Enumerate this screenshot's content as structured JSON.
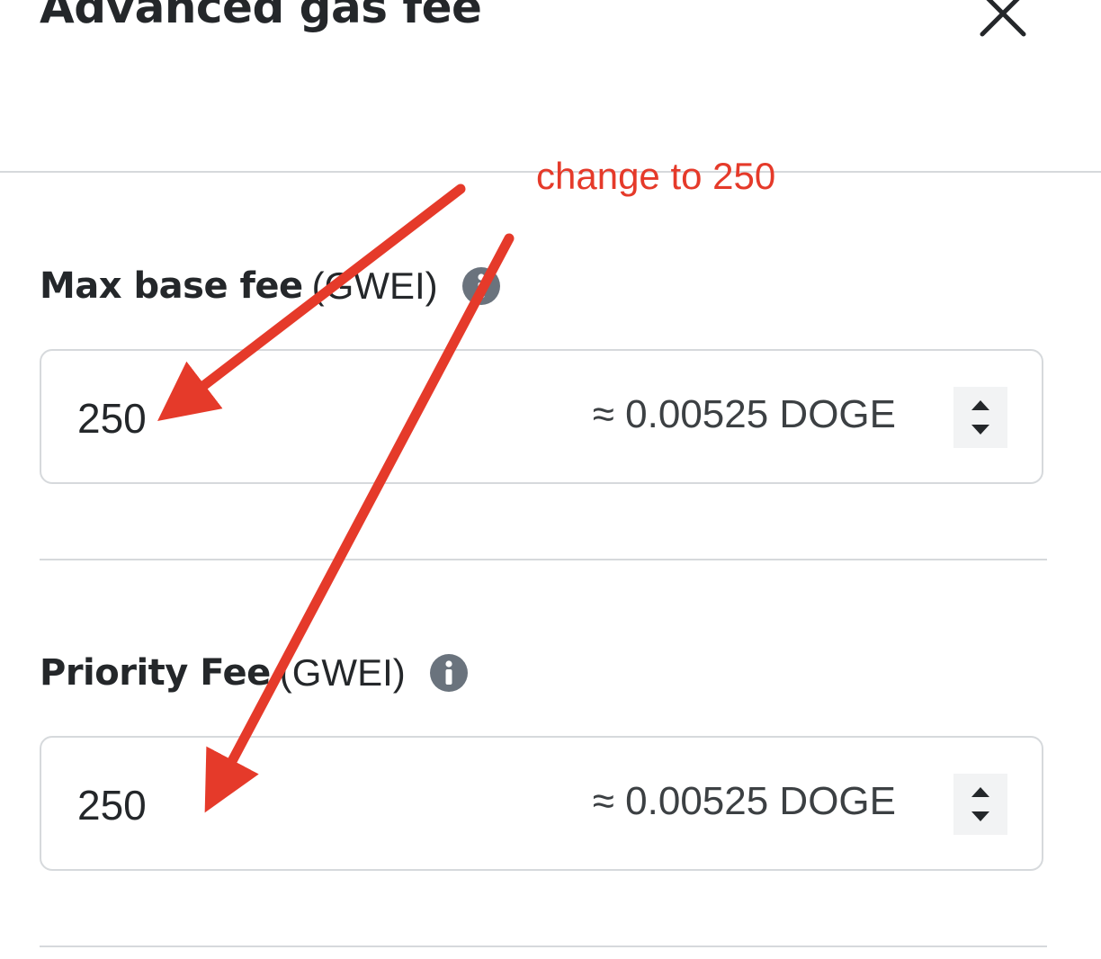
{
  "dialog": {
    "title": "Advanced gas fee",
    "close_icon": "close-icon"
  },
  "fields": {
    "max_base_fee": {
      "label": "Max base fee",
      "unit": "(GWEI)",
      "value": "250",
      "conversion": "≈ 0.00525 DOGE",
      "info_icon": "info-icon"
    },
    "priority_fee": {
      "label": "Priority Fee",
      "unit": "(GWEI)",
      "value": "250",
      "conversion": "≈ 0.00525 DOGE",
      "info_icon": "info-icon"
    }
  },
  "annotation": {
    "text": "change to 250",
    "color": "#e53a2a"
  },
  "colors": {
    "text": "#24272a",
    "border": "#d6d9dc",
    "icon": "#6a737d",
    "stepper_bg": "#f2f3f4"
  }
}
